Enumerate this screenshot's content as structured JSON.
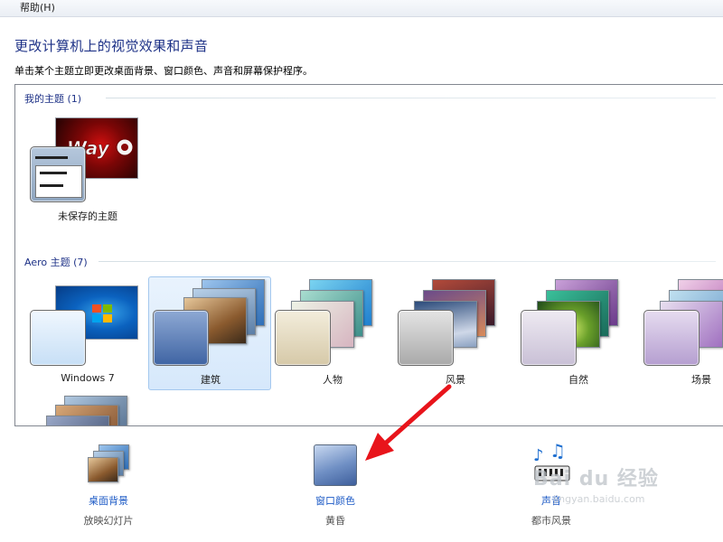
{
  "menu": {
    "edge_char": ")",
    "help": "帮助(H)"
  },
  "header": {
    "title": "更改计算机上的视觉效果和声音",
    "subtitle": "单击某个主题立即更改桌面背景、窗口颜色、声音和屏幕保护程序。"
  },
  "my_themes": {
    "heading": "我的主题 (1)",
    "items": [
      {
        "label": "未保存的主题"
      }
    ]
  },
  "aero_themes": {
    "heading": "Aero 主题 (7)",
    "items": [
      {
        "label": "Windows 7",
        "color": "#cfe3f7"
      },
      {
        "label": "建筑",
        "color": "#5f82b8",
        "selected": true
      },
      {
        "label": "人物",
        "color": "#e2d8bf"
      },
      {
        "label": "风景",
        "color": "#b9b9b9"
      },
      {
        "label": "自然",
        "color": "#d6d0df"
      },
      {
        "label": "场景",
        "color": "#cbbcd9"
      }
    ]
  },
  "bottom": {
    "desktop_bg": {
      "label": "桌面背景",
      "sub": "放映幻灯片"
    },
    "window_color": {
      "label": "窗口颜色",
      "sub": "黄昏"
    },
    "sound": {
      "label": "声音",
      "sub": "都市风景"
    }
  },
  "watermark": {
    "text": "Bai du 经验",
    "url": "jingyan.baidu.com"
  }
}
